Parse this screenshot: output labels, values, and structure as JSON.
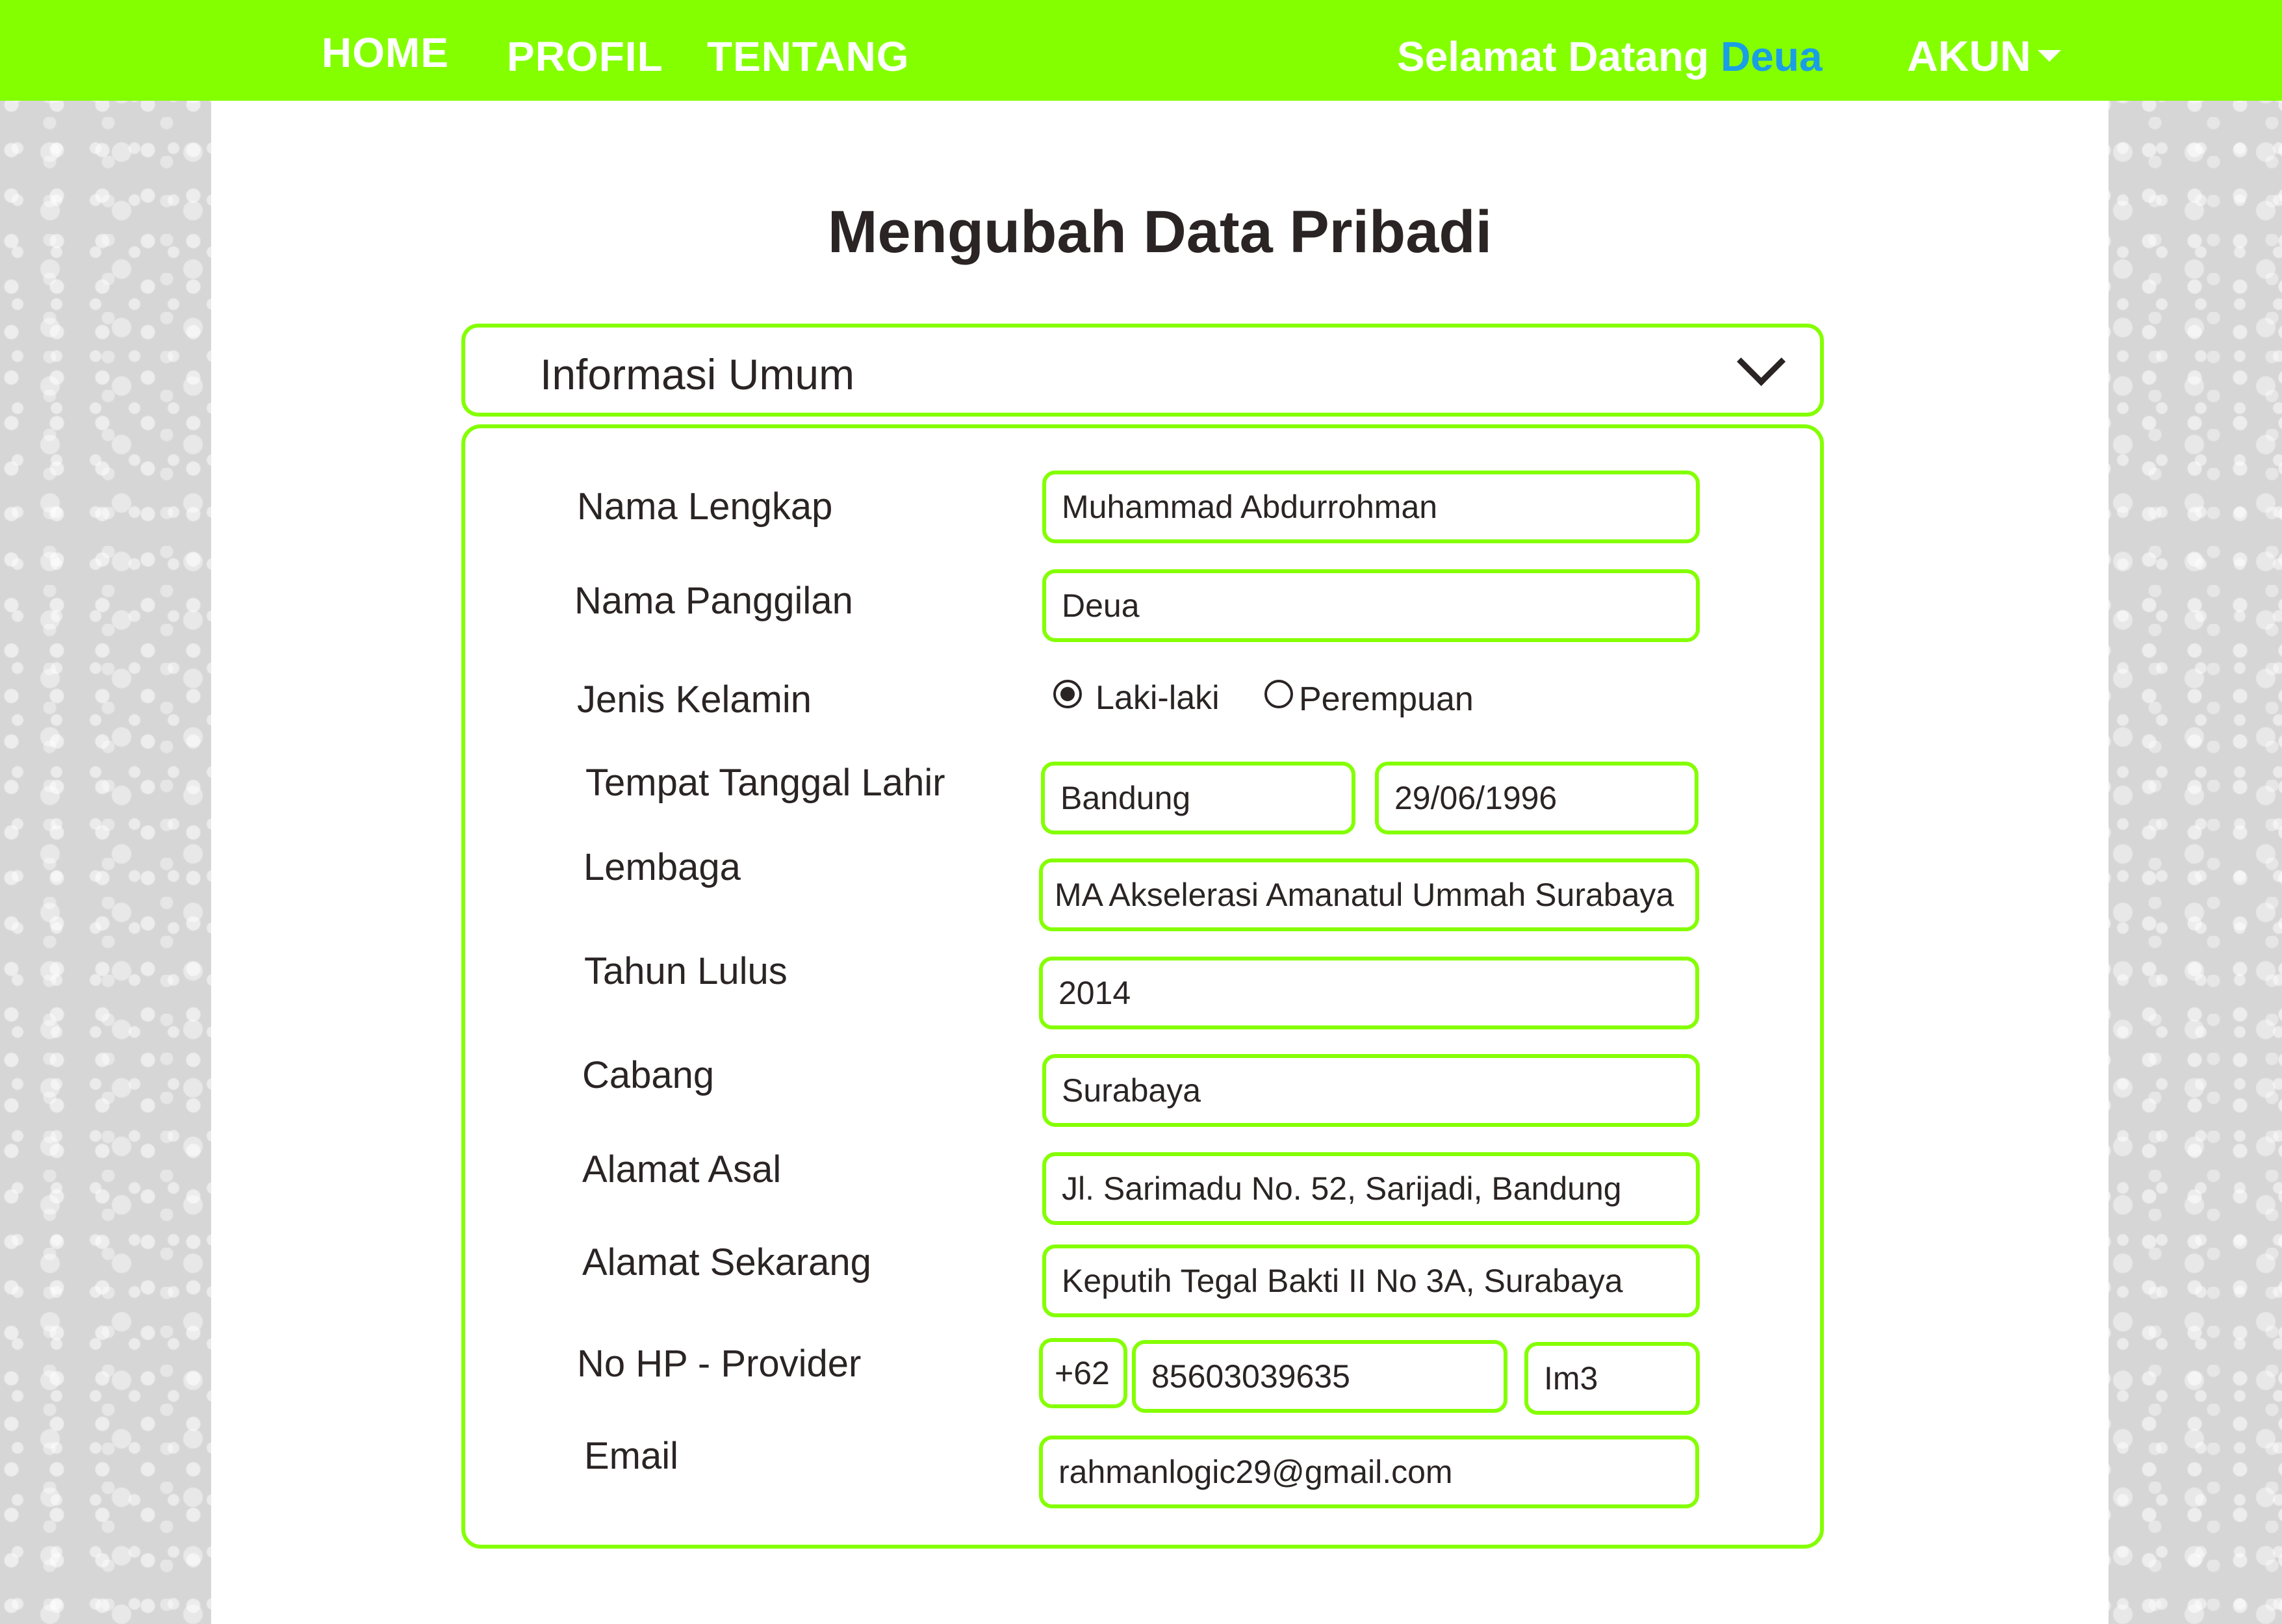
{
  "nav": {
    "home": "HOME",
    "profile": "PROFIL",
    "about": "TENTANG",
    "welcome_text": "Selamat Datang",
    "username": "Deua",
    "account": "AKUN"
  },
  "page": {
    "title": "Mengubah Data Pribadi"
  },
  "section": {
    "title": "Informasi Umum",
    "state_icon": "chevron-down-icon"
  },
  "form": {
    "full_name": {
      "label": "Nama Lengkap",
      "value": "Muhammad Abdurrohman"
    },
    "nickname": {
      "label": "Nama Panggilan",
      "value": "Deua"
    },
    "gender": {
      "label": "Jenis Kelamin",
      "options": [
        "Laki-laki",
        "Perempuan"
      ],
      "selected": "Laki-laki"
    },
    "birth": {
      "label": "Tempat Tanggal Lahir",
      "place": "Bandung",
      "date": "29/06/1996"
    },
    "institution": {
      "label": "Lembaga",
      "value": "MA Akselerasi Amanatul Ummah Surabaya"
    },
    "graduation_year": {
      "label": "Tahun Lulus",
      "value": "2014"
    },
    "branch": {
      "label": "Cabang",
      "value": "Surabaya"
    },
    "origin_address": {
      "label": "Alamat Asal",
      "value": "Jl. Sarimadu No. 52, Sarijadi, Bandung"
    },
    "current_address": {
      "label": "Alamat Sekarang",
      "value": "Keputih Tegal Bakti II No 3A, Surabaya"
    },
    "phone": {
      "label": "No HP - Provider",
      "country_code": "+62",
      "number": "85603039635",
      "provider": "Im3"
    },
    "email": {
      "label": "Email",
      "value": "rahmanlogic29@gmail.com"
    }
  },
  "colors": {
    "accent": "#84ff00",
    "username": "#1a9ee6",
    "text": "#2b2424",
    "background_pattern": "#d6d6d6"
  }
}
